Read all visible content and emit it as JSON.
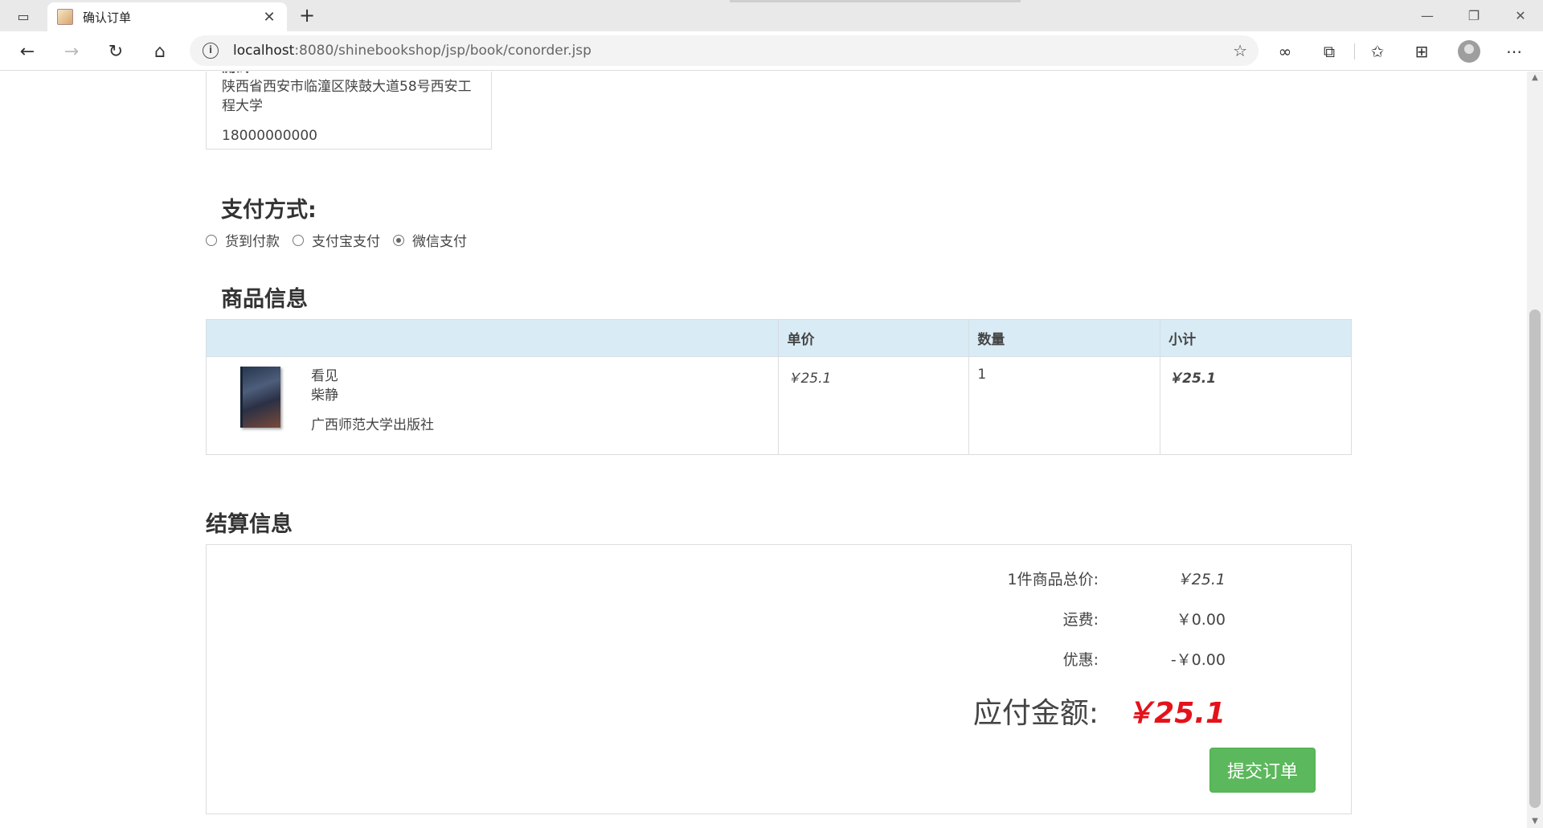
{
  "browser": {
    "tab_title": "确认订单",
    "url_host": "localhost",
    "url_rest": ":8080/shinebookshop/jsp/book/conorder.jsp"
  },
  "address_card": {
    "name": "测试",
    "address": "陕西省西安市临潼区陕鼓大道58号西安工程大学",
    "phone": "18000000000"
  },
  "payment": {
    "title": "支付方式:",
    "options": [
      "货到付款",
      "支付宝支付",
      "微信支付"
    ],
    "selected_index": 2
  },
  "goods": {
    "title": "商品信息",
    "headers": [
      "",
      "单价",
      "数量",
      "小计"
    ],
    "rows": [
      {
        "title": "看见",
        "author": "柴静",
        "publisher": "广西师范大学出版社",
        "unit_price": "￥25.1",
        "quantity": "1",
        "subtotal": "￥25.1"
      }
    ]
  },
  "settlement": {
    "title": "结算信息",
    "total_label": "1件商品总价:",
    "total_value": "￥25.1",
    "shipping_label": "运费:",
    "shipping_value": "￥0.00",
    "discount_label": "优惠:",
    "discount_value": "-￥0.00",
    "due_label": "应付金额:",
    "due_value": "￥25.1",
    "submit_label": "提交订单"
  }
}
